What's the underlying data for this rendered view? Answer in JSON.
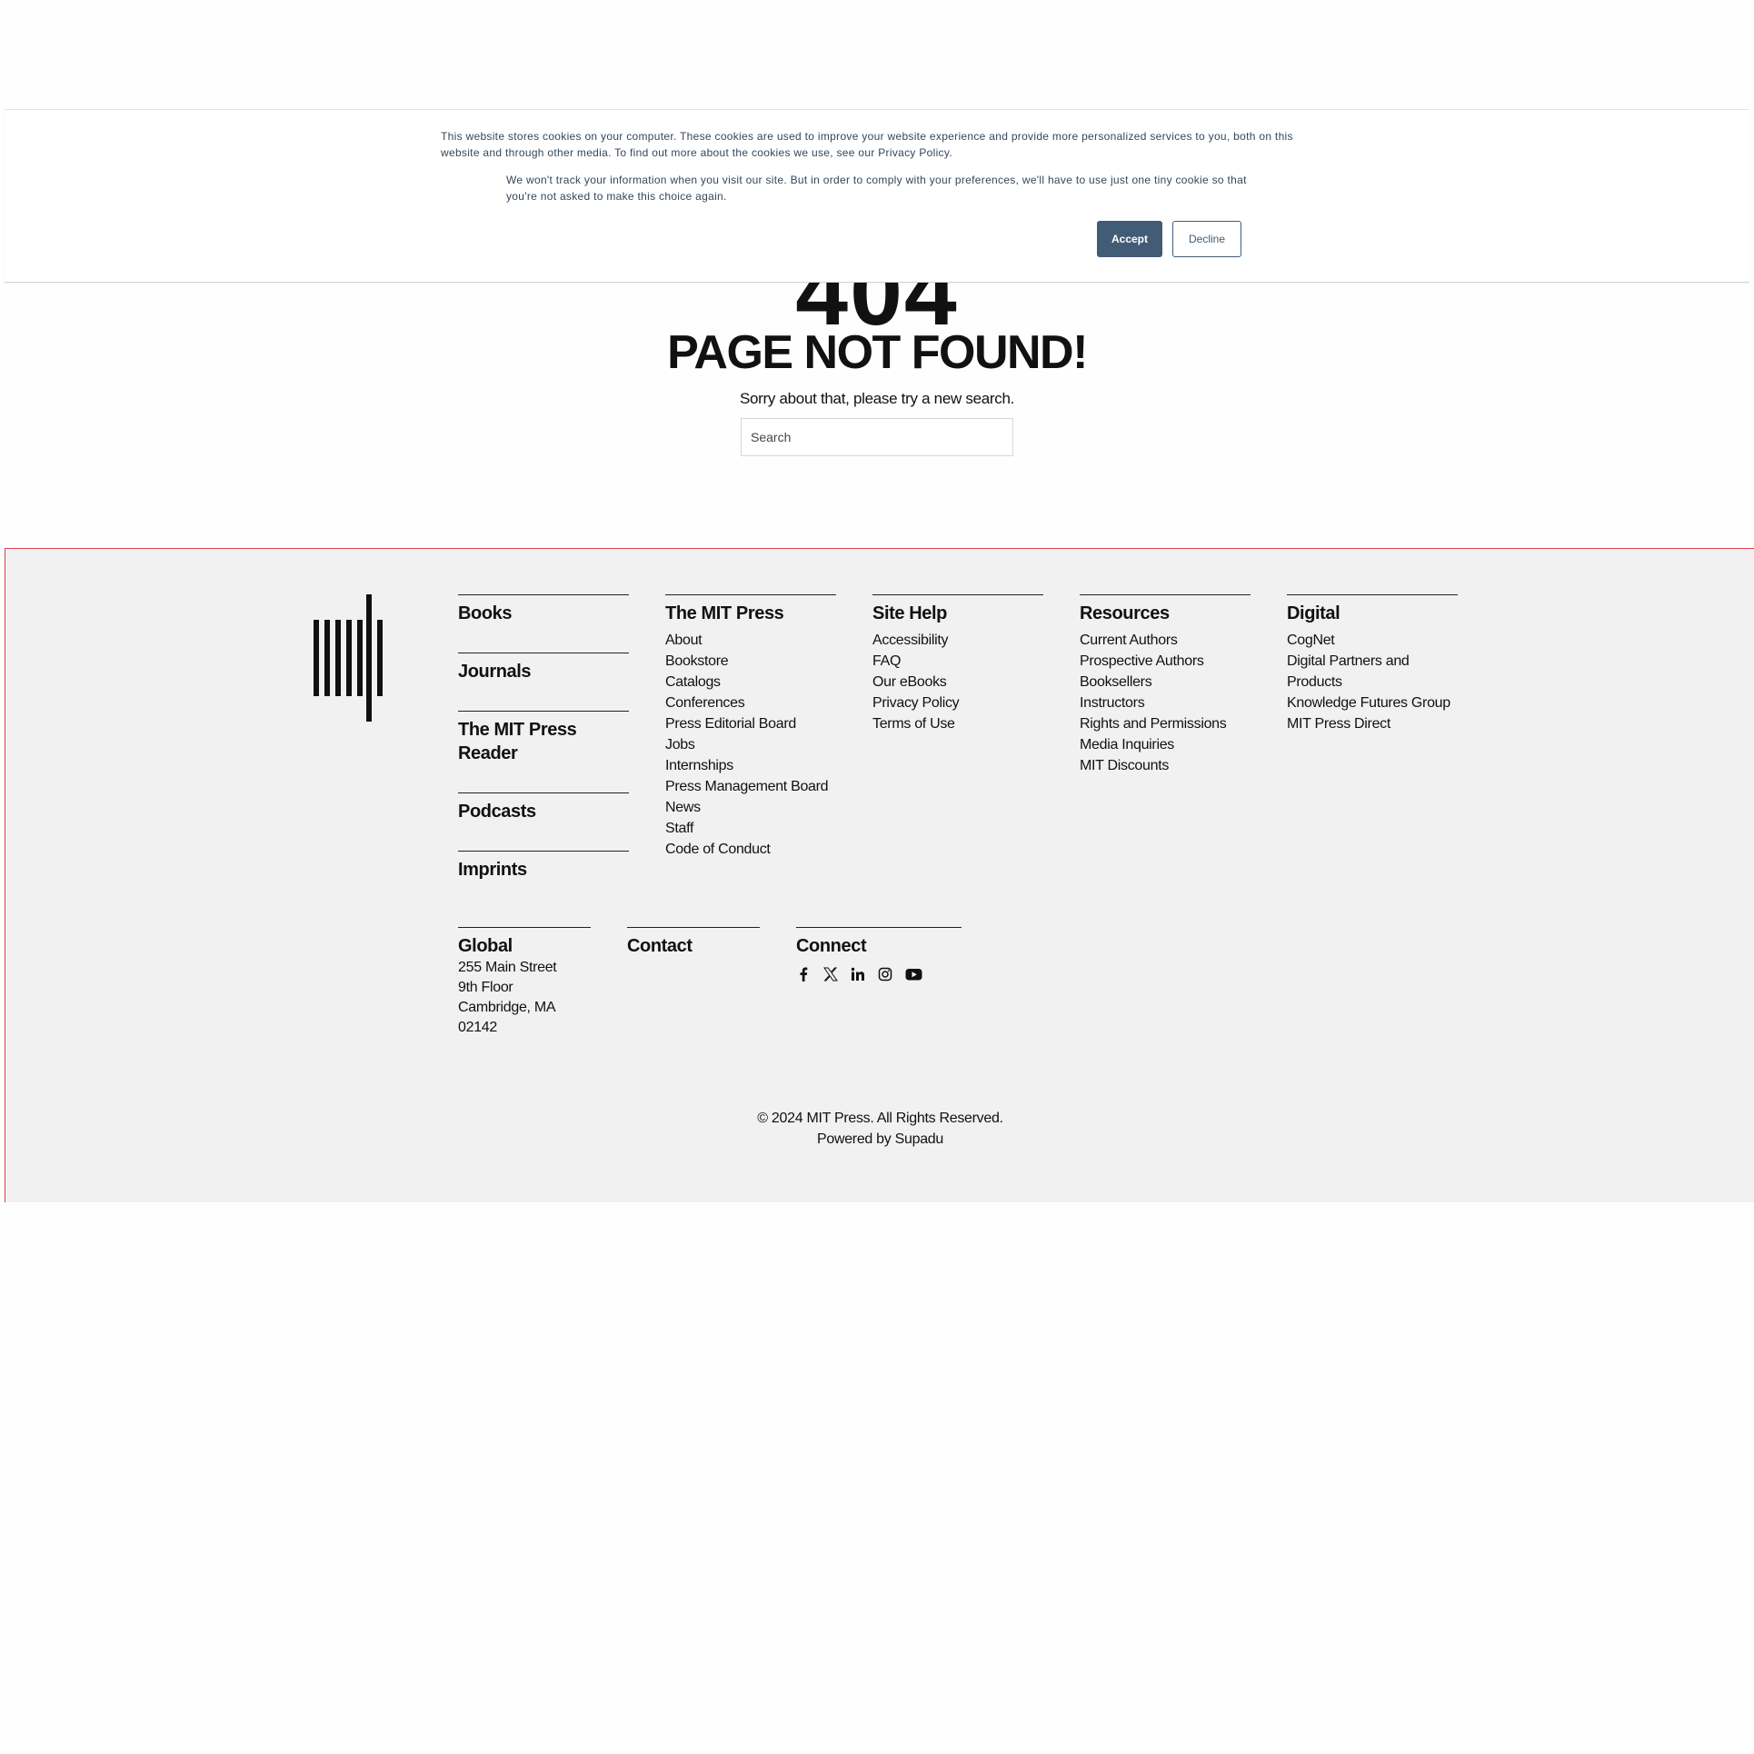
{
  "hero": {
    "code": "404",
    "title": "PAGE NOT FOUND!",
    "message": "Sorry about that, please try a new search.",
    "search_placeholder": "Search"
  },
  "cookie": {
    "text1": "This website stores cookies on your computer. These cookies are used to improve your website experience and provide more personalized services to you, both on this website and through other media. To find out more about the cookies we use, see our Privacy Policy.",
    "text2": "We won't track your information when you visit our site. But in order to comply with your preferences, we'll have to use just one tiny cookie so that you're not asked to make this choice again.",
    "accept_label": "Accept",
    "decline_label": "Decline",
    "accent_color": "#425b76"
  },
  "footer": {
    "stack": [
      "Books",
      "Journals",
      "The MIT Press Reader",
      "Podcasts",
      "Imprints"
    ],
    "columns": [
      {
        "title": "The MIT Press",
        "links": [
          "About",
          "Bookstore",
          "Catalogs",
          "Conferences",
          "Press Editorial Board",
          "Jobs",
          "Internships",
          "Press Management Board",
          "News",
          "Staff",
          "Code of Conduct"
        ]
      },
      {
        "title": "Site Help",
        "links": [
          "Accessibility",
          "FAQ",
          "Our eBooks",
          "Privacy Policy",
          "Terms of Use"
        ]
      },
      {
        "title": "Resources",
        "links": [
          "Current Authors",
          "Prospective Authors",
          "Booksellers",
          "Instructors",
          "Rights and Permissions",
          "Media Inquiries",
          "MIT Discounts"
        ]
      },
      {
        "title": "Digital",
        "links": [
          "CogNet",
          "Digital Partners and Products",
          "Knowledge Futures Group",
          "MIT Press Direct"
        ]
      }
    ],
    "global": {
      "title": "Global",
      "address": [
        "255 Main Street",
        "9th Floor",
        "Cambridge, MA",
        "02142"
      ]
    },
    "contact": {
      "title": "Contact"
    },
    "connect": {
      "title": "Connect",
      "icons": [
        "facebook-icon",
        "x-twitter-icon",
        "linkedin-icon",
        "instagram-icon",
        "youtube-icon"
      ]
    },
    "copyright": "© 2024 MIT Press. All Rights Reserved.",
    "powered_by": "Powered by Supadu"
  }
}
